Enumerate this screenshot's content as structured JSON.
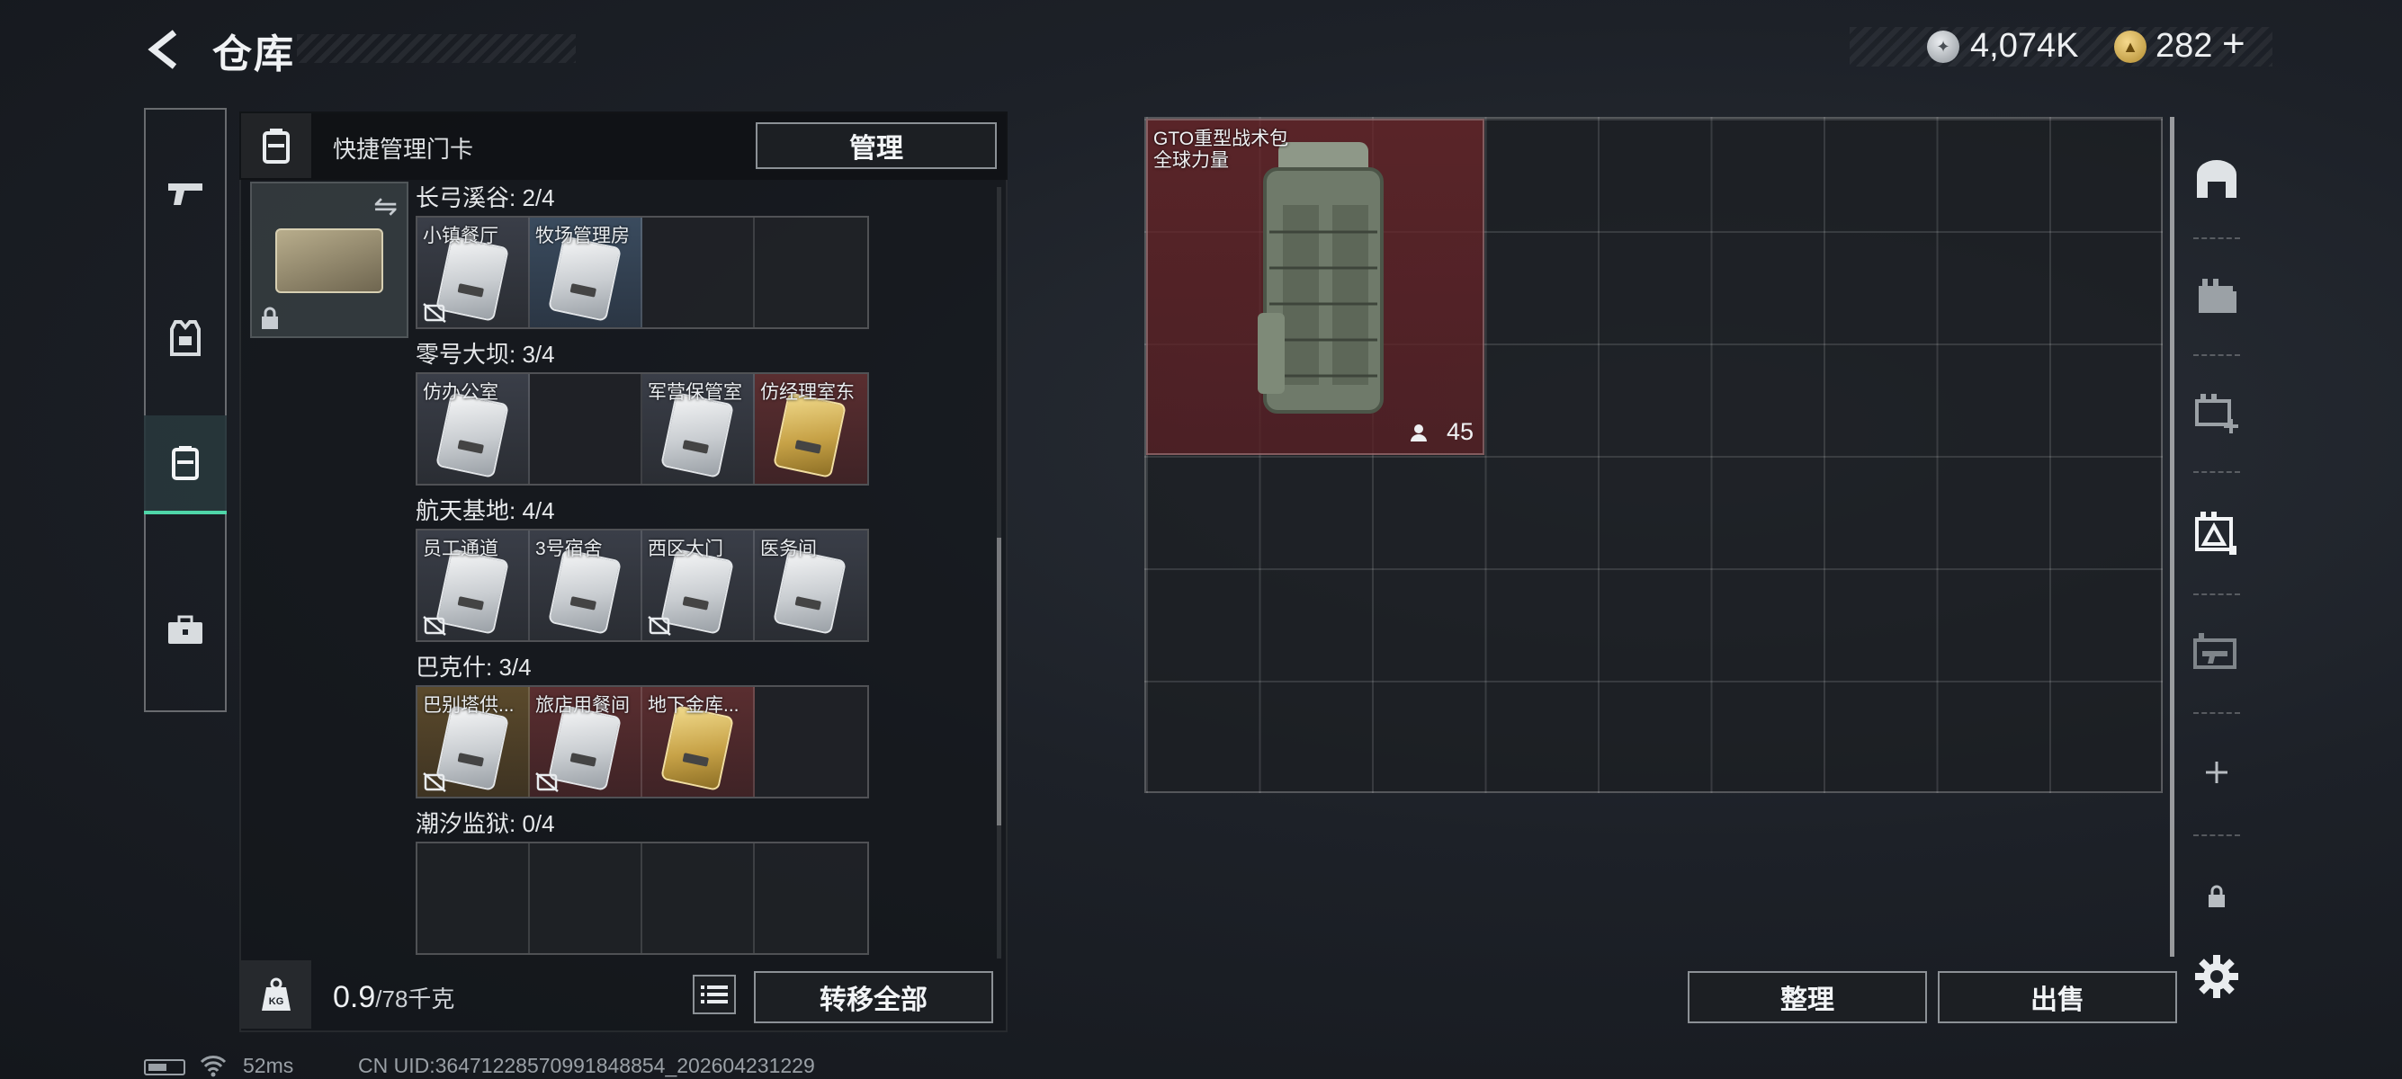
{
  "header": {
    "title": "仓库",
    "back_icon": "back-arrow-icon"
  },
  "currency": {
    "silver": {
      "icon": "silver-coin-icon",
      "value": "4,074K"
    },
    "gold": {
      "icon": "gold-coin-icon",
      "value": "282"
    },
    "plus_label": "+"
  },
  "left_nav": [
    {
      "name": "nav-weapon",
      "icon": "pistol-icon"
    },
    {
      "name": "nav-armor",
      "icon": "vest-icon"
    },
    {
      "name": "nav-keycards",
      "icon": "keycard-holder-icon",
      "active": true
    },
    {
      "name": "nav-toolbox",
      "icon": "briefcase-icon"
    }
  ],
  "panel": {
    "title": "快捷管理门卡",
    "manage_label": "管理",
    "swap_glyph": "⇋",
    "sections": [
      {
        "label": "长弓溪谷: 2/4",
        "slots": [
          {
            "name": "小镇餐厅",
            "color": "grey",
            "card": "white",
            "nodevice": true
          },
          {
            "name": "牧场管理房",
            "color": "blue",
            "card": "white",
            "nodevice": false
          },
          {
            "name": "",
            "color": "",
            "card": "",
            "nodevice": false
          },
          {
            "name": "",
            "color": "",
            "card": "",
            "nodevice": false
          }
        ]
      },
      {
        "label": "零号大坝: 3/4",
        "slots": [
          {
            "name": "仿办公室",
            "color": "grey",
            "card": "white",
            "nodevice": false
          },
          {
            "name": "",
            "color": "",
            "card": "",
            "nodevice": false
          },
          {
            "name": "军营保管室",
            "color": "grey",
            "card": "white",
            "nodevice": false
          },
          {
            "name": "仿经理室东",
            "color": "red",
            "card": "gold",
            "nodevice": false
          }
        ]
      },
      {
        "label": "航天基地: 4/4",
        "slots": [
          {
            "name": "员工通道",
            "color": "grey",
            "card": "white",
            "nodevice": true
          },
          {
            "name": "3号宿舍",
            "color": "grey",
            "card": "white",
            "nodevice": false
          },
          {
            "name": "西区大门",
            "color": "grey",
            "card": "white",
            "nodevice": true
          },
          {
            "name": "医务间",
            "color": "grey",
            "card": "white",
            "nodevice": false
          }
        ]
      },
      {
        "label": "巴克什: 3/4",
        "slots": [
          {
            "name": "巴别塔供...",
            "color": "gold",
            "card": "white",
            "nodevice": true
          },
          {
            "name": "旅店用餐间",
            "color": "red",
            "card": "white",
            "nodevice": true
          },
          {
            "name": "地下金库...",
            "color": "red",
            "card": "gold",
            "nodevice": false
          },
          {
            "name": "",
            "color": "",
            "card": "",
            "nodevice": false
          }
        ]
      },
      {
        "label": "潮汐监狱: 0/4",
        "slots": [
          {
            "name": "",
            "color": "",
            "card": "",
            "nodevice": false
          },
          {
            "name": "",
            "color": "",
            "card": "",
            "nodevice": false
          },
          {
            "name": "",
            "color": "",
            "card": "",
            "nodevice": false
          },
          {
            "name": "",
            "color": "",
            "card": "",
            "nodevice": false
          }
        ]
      }
    ],
    "weight_value": "0.9",
    "weight_capacity": "/78千克",
    "weight_icon_label": "KG",
    "transfer_all_label": "转移全部"
  },
  "storage": {
    "item": {
      "name": "GTO重型战术包",
      "brand": "全球力量",
      "count": "45",
      "count_icon": "person-icon"
    },
    "sort_label": "整理",
    "sell_label": "出售"
  },
  "right_nav": [
    {
      "name": "rnav-storage",
      "icon": "vault-icon"
    },
    {
      "name": "rnav-cases",
      "icon": "case-stack-icon"
    },
    {
      "name": "rnav-add-case",
      "icon": "add-case-icon"
    },
    {
      "name": "rnav-keycard-case",
      "icon": "keycard-case-icon",
      "active": true
    },
    {
      "name": "rnav-gun-case",
      "icon": "gun-case-icon"
    },
    {
      "name": "rnav-add",
      "icon": "plus-icon"
    },
    {
      "name": "rnav-lock",
      "icon": "lock-icon"
    }
  ],
  "status_bar": {
    "ping": "52ms",
    "uid": "CN UID:364712285709918488​54_202604231229"
  },
  "colors": {
    "accent": "#4fd6a8",
    "item_red": "#6e262a"
  }
}
